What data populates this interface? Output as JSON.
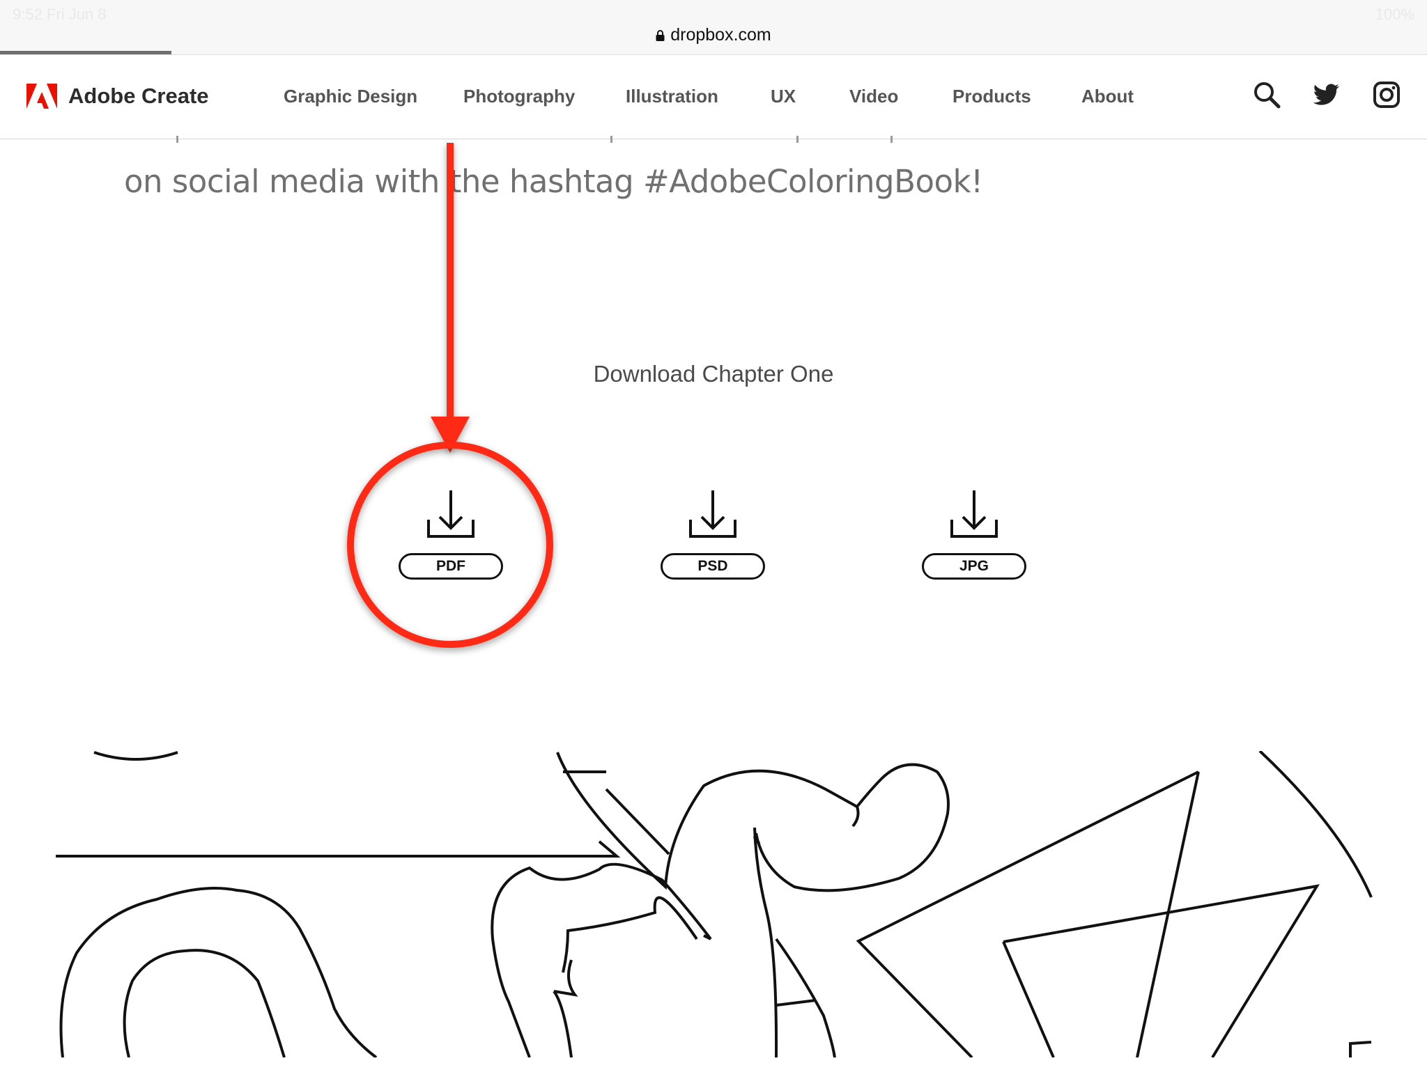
{
  "browser": {
    "status_left": "9:52 Fri Jun 8",
    "status_right": "100%",
    "url": "dropbox.com",
    "load_progress": 0.12
  },
  "nav": {
    "brand": "Adobe Create",
    "links": [
      "Graphic Design",
      "Photography",
      "Illustration",
      "UX",
      "Video",
      "Products",
      "About"
    ],
    "icons": [
      "search-icon",
      "twitter-icon",
      "instagram-icon"
    ]
  },
  "content": {
    "hashtag_line": "on social media with the hashtag #AdobeColoringBook!",
    "download_title": "Download Chapter One",
    "downloads": [
      {
        "label": "PDF",
        "icon": "download-icon"
      },
      {
        "label": "PSD",
        "icon": "download-icon"
      },
      {
        "label": "JPG",
        "icon": "download-icon"
      }
    ]
  },
  "annotation": {
    "color": "#ff2a12",
    "target": "PDF"
  },
  "colors": {
    "adobe_red": "#eb1000",
    "nav_text": "#555555"
  }
}
